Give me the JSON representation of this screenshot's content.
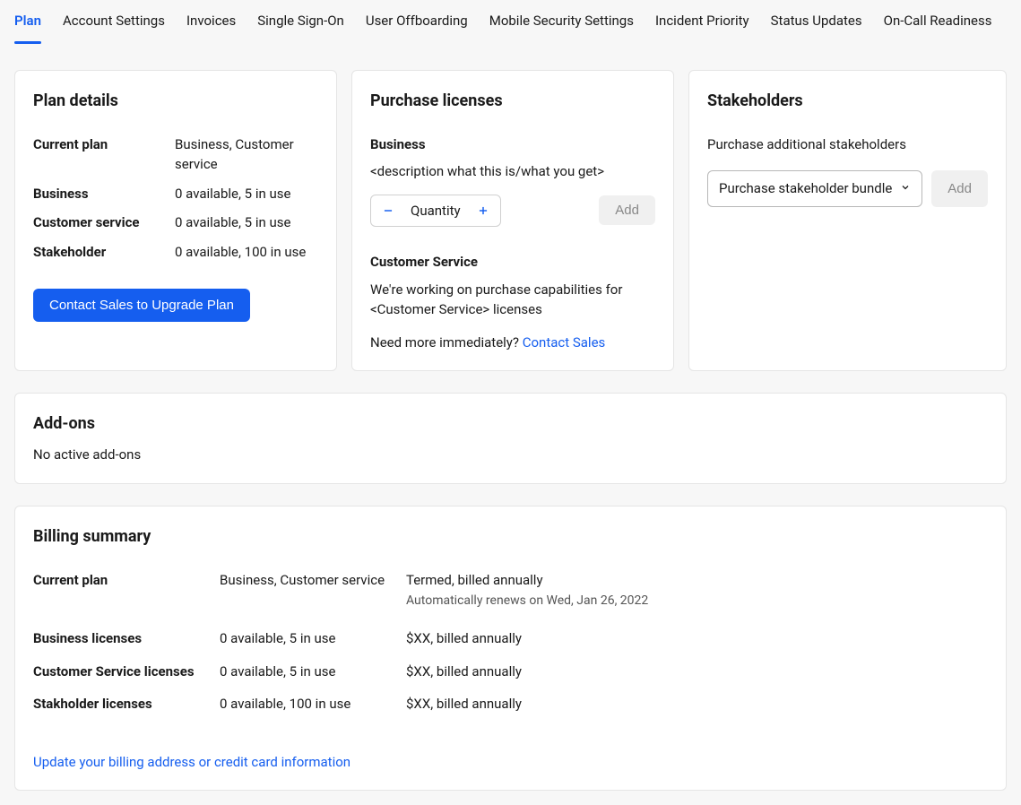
{
  "tabs": [
    {
      "label": "Plan",
      "active": true
    },
    {
      "label": "Account Settings"
    },
    {
      "label": "Invoices"
    },
    {
      "label": "Single Sign-On"
    },
    {
      "label": "User Offboarding"
    },
    {
      "label": "Mobile Security Settings"
    },
    {
      "label": "Incident Priority"
    },
    {
      "label": "Status Updates"
    },
    {
      "label": "On-Call Readiness"
    }
  ],
  "planDetails": {
    "title": "Plan details",
    "rows": [
      {
        "label": "Current plan",
        "value": "Business, Customer service"
      },
      {
        "label": "Business",
        "value": "0 available, 5 in use"
      },
      {
        "label": "Customer service",
        "value": "0 available, 5 in use"
      },
      {
        "label": "Stakeholder",
        "value": "0 available, 100 in use"
      }
    ],
    "cta": "Contact Sales to Upgrade Plan"
  },
  "purchase": {
    "title": "Purchase licenses",
    "business": {
      "label": "Business",
      "desc": "<description what this is/what you get>",
      "quantityLabel": "Quantity",
      "addLabel": "Add"
    },
    "customerService": {
      "label": "Customer Service",
      "desc": "We're working on purchase capabilities for <Customer Service> licenses",
      "prompt": "Need more immediately? ",
      "link": "Contact Sales"
    }
  },
  "stakeholders": {
    "title": "Stakeholders",
    "subtitle": "Purchase additional stakeholders",
    "selectLabel": "Purchase stakeholder bundle",
    "addLabel": "Add"
  },
  "addons": {
    "title": "Add-ons",
    "empty": "No active add-ons"
  },
  "billing": {
    "title": "Billing summary",
    "rows": [
      {
        "label": "Current plan",
        "col2": "Business, Customer service",
        "col3": "Termed, billed annually",
        "col3sub": "Automatically renews on Wed, Jan 26, 2022"
      },
      {
        "label": "Business licenses",
        "col2": "0 available, 5 in use",
        "col3": "$XX, billed annually"
      },
      {
        "label": "Customer Service licenses",
        "col2": "0 available, 5 in use",
        "col3": "$XX, billed annually"
      },
      {
        "label": "Stakholder licenses",
        "col2": "0 available, 100 in use",
        "col3": "$XX, billed annually"
      }
    ],
    "updateLink": "Update your billing address or credit card information"
  }
}
